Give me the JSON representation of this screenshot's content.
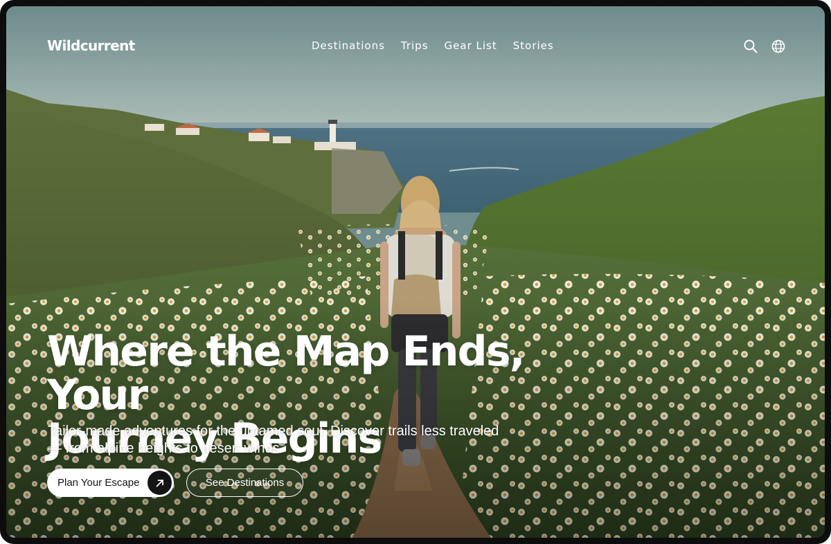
{
  "brand": {
    "name": "Wildcurrent"
  },
  "nav": {
    "links": [
      {
        "label": "Destinations"
      },
      {
        "label": "Trips"
      },
      {
        "label": "Gear List"
      },
      {
        "label": "Stories"
      }
    ],
    "icons": {
      "search": "search-icon",
      "language": "globe-icon"
    }
  },
  "hero": {
    "headline_line1": "Where the Map Ends, Your",
    "headline_line2": "Journey Begins",
    "subtext_line1": "Tailor-made adventures for the untamed soul. Discover trails less traveled",
    "subtext_line2": "— from alpine heights to desert winds.",
    "primary_cta": "Plan Your Escape",
    "primary_cta_icon": "arrow-up-right-icon",
    "secondary_cta": "See Destinations",
    "image": "photo of a hiker with a backpack walking a dirt trail through white daisy meadows toward a coastal lighthouse and the sea"
  },
  "colors": {
    "frame": "#0d0d0d",
    "text_light": "#ffffff",
    "button_dark": "#141414"
  }
}
